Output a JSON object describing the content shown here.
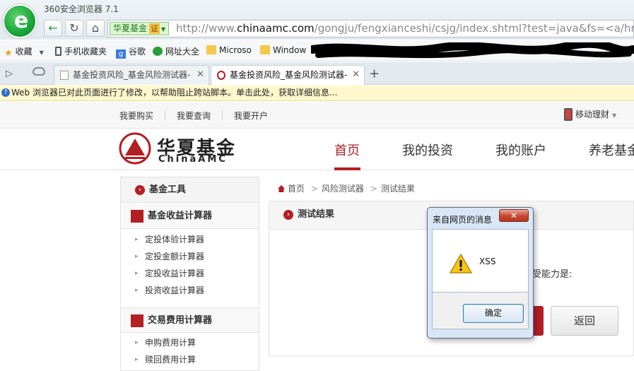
{
  "browser": {
    "app_title": "360安全浏览器 7.1",
    "site_badge": "华夏基金",
    "cert_label": "证",
    "url_prefix": "http://www.",
    "url_host": "chinaamc.com",
    "url_path": "/gongju/fengxianceshi/csjg/index.shtml?test=java&fs=<a/href=",
    "bookmarks": [
      {
        "label": "收藏",
        "icon": "star-icon"
      },
      {
        "label": "手机收藏夹",
        "icon": "phone-icon"
      },
      {
        "label": "谷歌",
        "icon": "google-icon"
      },
      {
        "label": "网址大全",
        "icon": "globe-icon"
      },
      {
        "label": "Microso",
        "icon": "folder-icon"
      },
      {
        "label": "Window",
        "icon": "folder-icon"
      }
    ],
    "tabs": [
      {
        "label": "基金投资风险_基金风险测试器-",
        "active": false
      },
      {
        "label": "基金投资风险_基金风险测试器-",
        "active": true
      }
    ],
    "tab_close": "✕",
    "new_tab": "+",
    "infobar": "Web 浏览器已对此页面进行了修改，以帮助阻止跨站脚本。单击此处，获取详细信息..."
  },
  "site": {
    "topnav": [
      "我要购买",
      "我要查询",
      "我要开户"
    ],
    "mobile": "移动理财",
    "brand_cn": "华夏基金",
    "brand_en": "ChinaAMC",
    "mainnav": [
      "首页",
      "我的投资",
      "我的账户",
      "养老基金"
    ],
    "sidebar": {
      "head": "基金工具",
      "groups": [
        {
          "title": "基金收益计算器",
          "items": [
            "定投体验计算器",
            "定投金额计算器",
            "定投收益计算器",
            "投资收益计算器"
          ]
        },
        {
          "title": "交易费用计算器",
          "items": [
            "申购费用计算",
            "赎回费用计算"
          ]
        }
      ]
    },
    "breadcrumb": [
      "首页",
      "风险测试器",
      "测试结果"
    ],
    "result_title": "测试结果",
    "risk_text": "受能力是:",
    "back_button": "返回"
  },
  "dialog": {
    "title": "来自网页的消息",
    "message": "XSS",
    "ok": "确定",
    "close": "✕"
  },
  "colors": {
    "brand_red": "#b21f24",
    "badge_green": "#1c7a11"
  }
}
